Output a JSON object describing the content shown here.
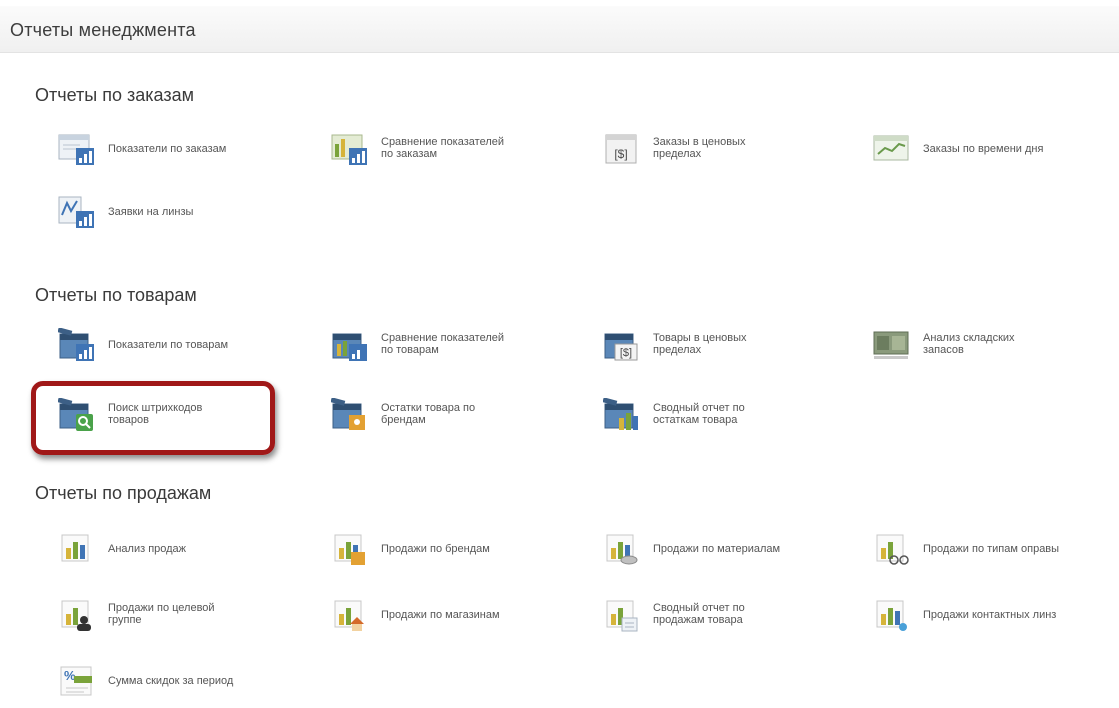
{
  "page": {
    "title": "Отчеты менеджмента"
  },
  "sections": [
    {
      "title": "Отчеты по заказам",
      "items": [
        {
          "label": "Показатели по заказам",
          "icon": "chart-document-icon"
        },
        {
          "label": "Сравнение показателей\nпо заказам",
          "icon": "chart-comparison-icon"
        },
        {
          "label": "Заказы в ценовых\nпределах",
          "icon": "price-range-icon"
        },
        {
          "label": "Заказы по времени дня",
          "icon": "time-chart-icon"
        },
        {
          "label": "Заявки на линзы",
          "icon": "lens-chart-icon"
        }
      ]
    },
    {
      "title": "Отчеты по товарам",
      "items": [
        {
          "label": "Показатели по товарам",
          "icon": "products-chart-icon"
        },
        {
          "label": "Сравнение показателей\nпо товарам",
          "icon": "products-comparison-icon"
        },
        {
          "label": "Товары в ценовых\nпределах",
          "icon": "products-price-icon"
        },
        {
          "label": "Анализ складских\nзапасов",
          "icon": "warehouse-icon"
        },
        {
          "label": "Поиск штрихкодов\nтоваров",
          "icon": "barcode-search-icon"
        },
        {
          "label": "Остатки товара по\nбрендам",
          "icon": "brand-stock-icon"
        },
        {
          "label": "Сводный отчет по\nостаткам товара",
          "icon": "stock-summary-icon"
        }
      ]
    },
    {
      "title": "Отчеты по продажам",
      "items": [
        {
          "label": "Анализ продаж",
          "icon": "sales-chart-icon"
        },
        {
          "label": "Продажи по брендам",
          "icon": "sales-brand-icon"
        },
        {
          "label": "Продажи по материалам",
          "icon": "sales-material-icon"
        },
        {
          "label": "Продажи по типам оправы",
          "icon": "sales-frame-icon"
        },
        {
          "label": "Продажи по целевой\nгруппе",
          "icon": "sales-target-group-icon"
        },
        {
          "label": "Продажи по магазинам",
          "icon": "sales-store-icon"
        },
        {
          "label": "Сводный отчет по\nпродажам товара",
          "icon": "sales-summary-icon"
        },
        {
          "label": "Продажи контактных линз",
          "icon": "sales-contact-lens-icon"
        },
        {
          "label": "Сумма скидок за период",
          "icon": "discount-icon"
        }
      ]
    }
  ]
}
